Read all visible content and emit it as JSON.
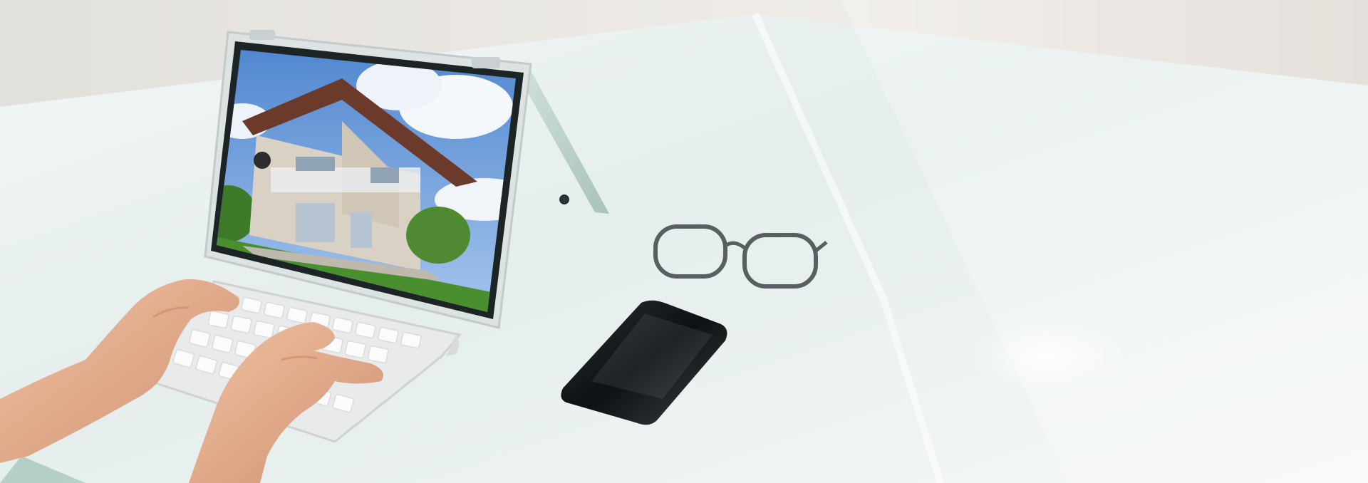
{
  "scene": {
    "description_visible_text": "",
    "palette": {
      "background_wall": "#e9e6e1",
      "glass_desk": "#dfe9e7",
      "glass_desk_edge": "#b8cfc9",
      "tablet_body": "#e8ecec",
      "tablet_bezel": "#1d2426",
      "sky": "#5a8fd2",
      "cloud": "#f4f7fb",
      "house_wall": "#d9d2c4",
      "roof": "#6b3a2a",
      "grass": "#4a8f2f",
      "keyboard": "#eeeeef",
      "keys": "#fafafa",
      "phone": "#14181b",
      "skin": "#e2ad8f",
      "glasses": "#2a2f33"
    },
    "icons": [
      "house-photo",
      "tablet-device",
      "keyboard-device",
      "smartphone-device",
      "eyeglasses",
      "hands"
    ]
  }
}
